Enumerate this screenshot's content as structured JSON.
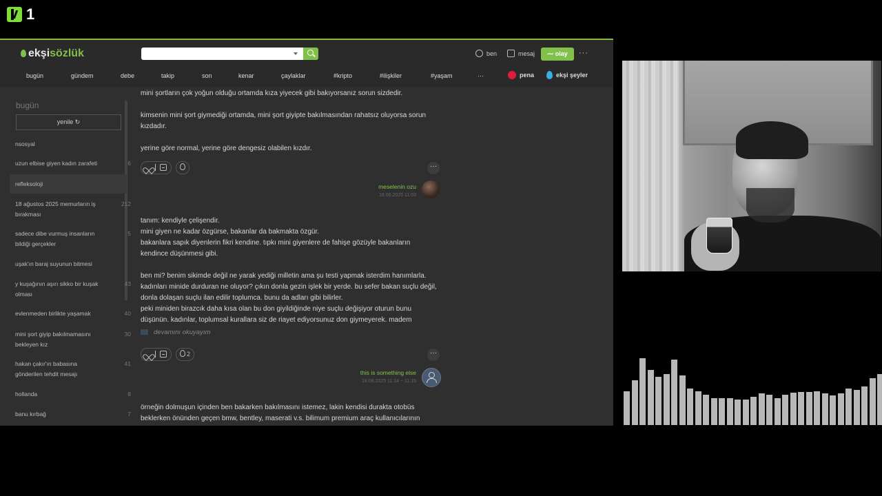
{
  "overlay": {
    "channel_number": "1"
  },
  "site": {
    "logo_prefix": "ekşi",
    "logo_suffix": "sözlük",
    "search": {
      "placeholder": "",
      "value": ""
    },
    "top_actions": {
      "ben": "ben",
      "mesaj": "mesaj",
      "olay": "olay",
      "more": "···"
    },
    "nav": [
      "bugün",
      "gündem",
      "debe",
      "takip",
      "son",
      "kenar",
      "çaylaklar",
      "#kripto",
      "#ilişkiler",
      "#yaşam",
      "···"
    ],
    "nav_pena": "pena",
    "nav_seyler": "ekşi şeyler"
  },
  "sidebar": {
    "title": "bugün",
    "refresh_label": "yenile ↻",
    "items": [
      {
        "line1": "nsosyal",
        "line2": "",
        "count": ""
      },
      {
        "line1": "uzun elbise giyen kadın zarafeti",
        "line2": "",
        "count": "6"
      },
      {
        "line1": "refleksoloji",
        "line2": "",
        "count": ""
      },
      {
        "line1": "18 ağustos 2025 memurların iş",
        "line2": "bırakması",
        "count": "212"
      },
      {
        "line1": "sadece dibe vurmuş insanların",
        "line2": "bildiği gerçekler",
        "count": "5"
      },
      {
        "line1": "uşak'ın baraj suyunun bitmesi",
        "line2": "",
        "count": ""
      },
      {
        "line1": "y kuşağının aşırı sikko bir kuşak",
        "line2": "olması",
        "count": "43"
      },
      {
        "line1": "evlenmeden birlikte yaşamak",
        "line2": "",
        "count": "40"
      },
      {
        "line1": "mini şort giyip bakılmamasını",
        "line2": "bekleyen kız",
        "count": "30"
      },
      {
        "line1": "hakan çakır'ın babasına",
        "line2": "gönderilen tehdit mesajı",
        "count": "41"
      },
      {
        "line1": "hollanda",
        "line2": "",
        "count": "8"
      },
      {
        "line1": "banu kırbağ",
        "line2": "",
        "count": "7"
      }
    ]
  },
  "entries": {
    "e1": {
      "p1": "mini şortların çok yoğun olduğu ortamda kıza yiyecek gibi bakıyorsanız sorun sizdedir.",
      "p2a": "kimsenin mini şort giymediği ortamda, mini şort giyipte bakılmasından rahatsız oluyorsa sorun",
      "p2b": "kızdadır.",
      "p3": "yerine göre normal, yerine göre dengesiz olabilen kızdır.",
      "author": "meselenin ozu",
      "date": "18.08.2025 11:03"
    },
    "e2": {
      "lines": [
        "tanım: kendiyle çelişendir.",
        "mini giyen ne kadar özgürse, bakanlar da bakmakta özgür.",
        "bakanlara sapık diyenlerin fikri kendine. tıpkı mini giyenlere de fahişe gözüyle bakanların",
        "kendince düşünmesi gibi.",
        "",
        "ben mi? benim sikimde değil ne yarak yediği milletin ama şu testi yapmak isterdim hanımlarla.",
        "kadınları minide durduran ne oluyor? çıkın donla gezin işlek bir yerde. bu sefer bakan suçlu değil,",
        "donla dolaşan suçlu ilan edilir toplumca. bunu da adları gibi bilirler.",
        "peki miniden birazcık daha kısa olan bu don giyildiğinde niye suçlu değişiyor oturun bunu",
        "düşünün. kadınlar, toplumsal kurallara siz de riayet ediyorsunuz don giymeyerek. madem"
      ],
      "read_more": "devamını okuyayım",
      "drop_count": "2",
      "author": "this is something else",
      "date": "18.08.2025 11:14 ~ 11:15"
    },
    "e3": {
      "line1": "örneğin dolmuşun içinden ben bakarken bakılmasını istemez, lakin kendisi durakta otobüs",
      "line2": "beklerken önünden geçen bmw, bentley, maserati v.s. bilimum premium araç kullanıcılarının"
    }
  },
  "audio_levels": [
    0.48,
    0.64,
    0.95,
    0.78,
    0.69,
    0.73,
    0.93,
    0.71,
    0.52,
    0.48,
    0.43,
    0.38,
    0.38,
    0.38,
    0.36,
    0.36,
    0.4,
    0.45,
    0.43,
    0.38,
    0.43,
    0.46,
    0.47,
    0.47,
    0.48,
    0.45,
    0.42,
    0.45,
    0.52,
    0.5,
    0.55,
    0.67,
    0.73
  ]
}
